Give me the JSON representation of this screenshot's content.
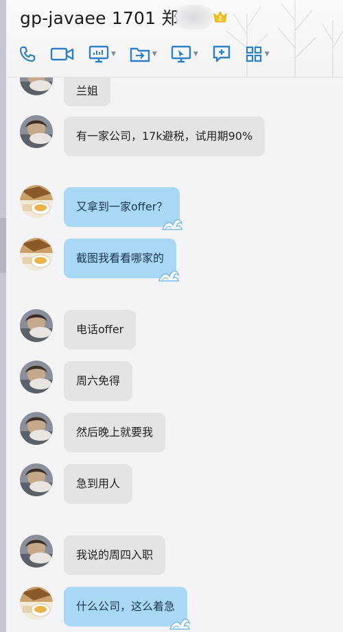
{
  "header": {
    "title": "gp-javaee 1701 郑",
    "crown_badge": "2"
  },
  "toolbar": {
    "items": [
      {
        "icon": "phone-icon"
      },
      {
        "icon": "video-icon"
      },
      {
        "icon": "screen-share-icon",
        "has_menu": true
      },
      {
        "icon": "file-transfer-icon",
        "has_menu": true
      },
      {
        "icon": "remote-desktop-icon",
        "has_menu": true
      },
      {
        "icon": "add-app-icon"
      },
      {
        "icon": "apps-grid-icon",
        "has_menu": true
      }
    ]
  },
  "messages": [
    {
      "sender": "other",
      "text": "兰姐",
      "style": "gray"
    },
    {
      "sender": "other",
      "text": "有一家公司，17k避税，试用期90%",
      "style": "gray"
    },
    {
      "sender": "self",
      "text": "又拿到一家offer？",
      "style": "blue"
    },
    {
      "sender": "self",
      "text": "截图我看看哪家的",
      "style": "blue"
    },
    {
      "sender": "other",
      "text": "电话offer",
      "style": "gray"
    },
    {
      "sender": "other",
      "text": "周六免得",
      "style": "gray"
    },
    {
      "sender": "other",
      "text": "然后晚上就要我",
      "style": "gray"
    },
    {
      "sender": "other",
      "text": "急到用人",
      "style": "gray"
    },
    {
      "sender": "other",
      "text": "我说的周四入职",
      "style": "gray"
    },
    {
      "sender": "self",
      "text": "什么公司，这么着急",
      "style": "blue"
    }
  ],
  "colors": {
    "self_bubble": "#a9d8f5",
    "other_bubble": "#e4e4e6",
    "icon_blue": "#2b7fc9",
    "crown": "#f5c518"
  }
}
